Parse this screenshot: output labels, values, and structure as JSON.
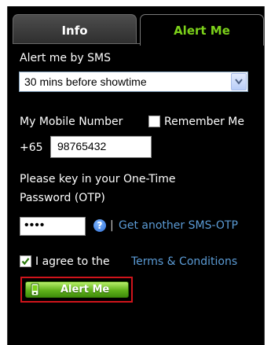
{
  "tabs": [
    {
      "label": "Info"
    },
    {
      "label": "Alert Me"
    }
  ],
  "sms": {
    "label": "Alert me by SMS",
    "selected": "30 mins before showtime"
  },
  "mobile": {
    "label": "My Mobile Number",
    "remember_label": "Remember Me",
    "prefix": "+65",
    "number": "98765432"
  },
  "otp": {
    "instruction_line1": "Please key in your One-Time",
    "instruction_line2": "Password (OTP)",
    "value": "••••",
    "separator": "|",
    "link": "Get another SMS-OTP"
  },
  "agree": {
    "text": "I agree to the",
    "link": "Terms & Conditions",
    "checked": true
  },
  "button": {
    "label": "Alert Me"
  },
  "colors": {
    "accent": "#7cd11a",
    "link": "#5b9bd5",
    "highlight": "#d0141b"
  },
  "icons": [
    "chevron-down-icon",
    "check-icon",
    "help-icon",
    "mobile-phone-icon"
  ]
}
